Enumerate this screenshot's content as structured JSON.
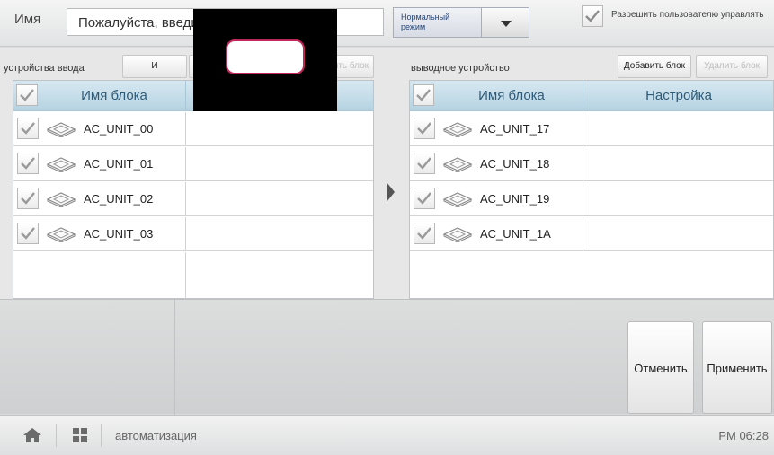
{
  "header": {
    "name_label": "Имя",
    "name_value": "Пожалуйста, введит",
    "mode_value": "Нормальный режим",
    "allow_label": "Разрешить пользователю управлять",
    "allow_checked": true
  },
  "input_panel": {
    "title": "устройства ввода",
    "add_button": "И",
    "add_button_2": "И",
    "delete_button": "Удалить блок",
    "col_name": "Имя блока",
    "rows": [
      {
        "name": "AC_UNIT_00",
        "icon": "ceiling-cassette-icon"
      },
      {
        "name": "AC_UNIT_01",
        "icon": "ceiling-cassette-icon"
      },
      {
        "name": "AC_UNIT_02",
        "icon": "ceiling-cassette-icon"
      },
      {
        "name": "AC_UNIT_03",
        "icon": "ceiling-cassette-icon"
      }
    ]
  },
  "output_panel": {
    "title": "выводное устройство",
    "add_button": "Добавить блок",
    "delete_button": "Удалить блок",
    "col_name": "Имя блока",
    "col_setting": "Настройка",
    "rows": [
      {
        "name": "AC_UNIT_17",
        "icon": "ceiling-cassette-icon"
      },
      {
        "name": "AC_UNIT_18",
        "icon": "ceiling-cassette-icon"
      },
      {
        "name": "AC_UNIT_19",
        "icon": "ceiling-cassette-icon"
      },
      {
        "name": "AC_UNIT_1A",
        "icon": "ceiling-cassette-icon"
      }
    ]
  },
  "actions": {
    "cancel": "Отменить",
    "apply": "Применить"
  },
  "statusbar": {
    "breadcrumb": "автоматизация",
    "time": "PM 06:28"
  },
  "colors": {
    "header_accent": "#b6d3e2",
    "header_text": "#2d5a78",
    "focus_ring": "#c0285a"
  }
}
